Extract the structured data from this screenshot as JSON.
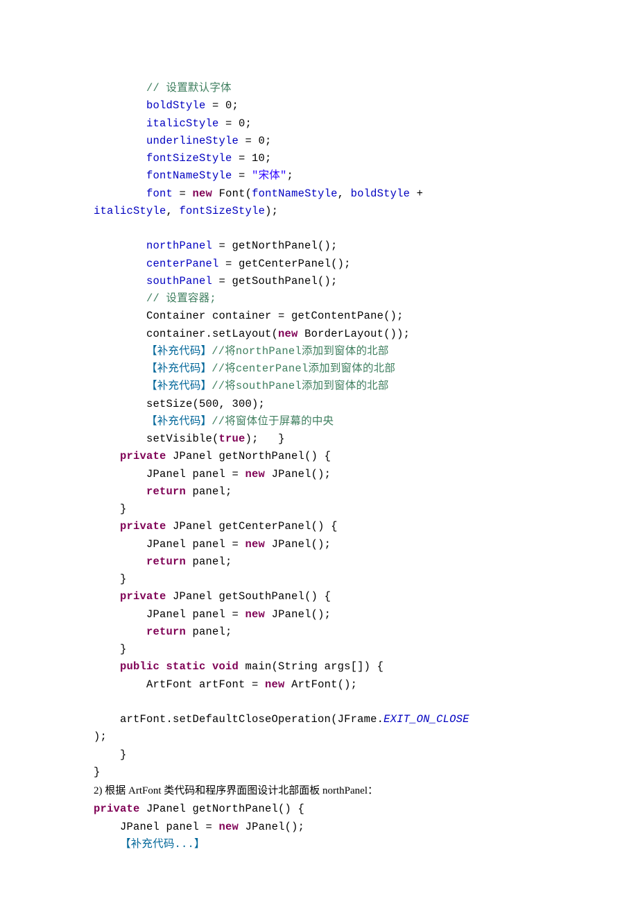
{
  "code1": {
    "l1": {
      "indent": "        ",
      "cm": "// 设置默认字体"
    },
    "l2": {
      "indent": "        ",
      "a": "boldStyle",
      "b": " = 0;"
    },
    "l3": {
      "indent": "        ",
      "a": "italicStyle",
      "b": " = 0;"
    },
    "l4": {
      "indent": "        ",
      "a": "underlineStyle",
      "b": " = 0;"
    },
    "l5": {
      "indent": "        ",
      "a": "fontSizeStyle",
      "b": " = 10;"
    },
    "l6": {
      "indent": "        ",
      "a": "fontNameStyle",
      "b": " = ",
      "c": "\"宋体\"",
      "d": ";"
    },
    "l7": {
      "indent": "        ",
      "a": "font",
      "b": " = ",
      "c": "new",
      "d": " Font(",
      "e": "fontNameStyle",
      "f": ", ",
      "g": "boldStyle",
      "h": " + "
    },
    "l8": {
      "a": "italicStyle",
      "b": ", ",
      "c": "fontSizeStyle",
      "d": ");"
    },
    "l10": {
      "indent": "        ",
      "a": "northPanel",
      "b": " = getNorthPanel();"
    },
    "l11": {
      "indent": "        ",
      "a": "centerPanel",
      "b": " = getCenterPanel();"
    },
    "l12": {
      "indent": "        ",
      "a": "southPanel",
      "b": " = getSouthPanel();"
    },
    "l13": {
      "indent": "        ",
      "cm": "// 设置容器;"
    },
    "l14": {
      "indent": "        ",
      "t": "Container container = getContentPane();"
    },
    "l15": {
      "indent": "        ",
      "a": "container.setLayout(",
      "b": "new",
      "c": " BorderLayout());"
    },
    "l16": {
      "indent": "        ",
      "a": "【补充代码】",
      "b": "//将",
      "c": "northPanel",
      "d": "添加到窗体的北部"
    },
    "l17": {
      "indent": "        ",
      "a": "【补充代码】",
      "b": "//将",
      "c": "centerPanel",
      "d": "添加到窗体的北部"
    },
    "l18": {
      "indent": "        ",
      "a": "【补充代码】",
      "b": "//将",
      "c": "southPanel",
      "d": "添加到窗体的北部"
    },
    "l19": {
      "indent": "        ",
      "t": "setSize(500, 300);"
    },
    "l20": {
      "indent": "        ",
      "a": "【补充代码】",
      "b": "//将窗体位于屏幕的中央"
    },
    "l21": {
      "indent": "        ",
      "a": "setVisible(",
      "b": "true",
      "c": ");   }"
    },
    "l22": {
      "indent": "    ",
      "a": "private",
      "b": " JPanel getNorthPanel() {"
    },
    "l23": {
      "indent": "        ",
      "a": "JPanel panel = ",
      "b": "new",
      "c": " JPanel();"
    },
    "l24": {
      "indent": "        ",
      "a": "return",
      "b": " panel;"
    },
    "l25": {
      "indent": "    ",
      "t": "}"
    },
    "l26": {
      "indent": "    ",
      "a": "private",
      "b": " JPanel getCenterPanel() {"
    },
    "l27": {
      "indent": "        ",
      "a": "JPanel panel = ",
      "b": "new",
      "c": " JPanel();"
    },
    "l28": {
      "indent": "        ",
      "a": "return",
      "b": " panel;"
    },
    "l29": {
      "indent": "    ",
      "t": "}"
    },
    "l30": {
      "indent": "    ",
      "a": "private",
      "b": " JPanel getSouthPanel() {"
    },
    "l31": {
      "indent": "        ",
      "a": "JPanel panel = ",
      "b": "new",
      "c": " JPanel();"
    },
    "l32": {
      "indent": "        ",
      "a": "return",
      "b": " panel;"
    },
    "l33": {
      "indent": "    ",
      "t": "}"
    },
    "l34": {
      "indent": "    ",
      "a": "public static void",
      "b": " main(String args[]) {"
    },
    "l35": {
      "indent": "        ",
      "a": "ArtFont artFont = ",
      "b": "new",
      "c": " ArtFont();"
    },
    "l37": {
      "indent": "    ",
      "a": "artFont.setDefaultCloseOperation(JFrame.",
      "b": "EXIT_ON_CLOSE"
    },
    "l38": {
      "t": ");"
    },
    "l39": {
      "indent": "    ",
      "t": "}"
    },
    "l40": {
      "t": "}"
    }
  },
  "q2": "2)   根据 ArtFont 类代码和程序界面图设计北部面板 northPanel：",
  "code2": {
    "l1": {
      "a": "private",
      "b": " JPanel getNorthPanel() {"
    },
    "l2": {
      "indent": "    ",
      "a": "JPanel panel = ",
      "b": "new",
      "c": " JPanel();"
    },
    "l3": {
      "indent": "    ",
      "a": "【补充代码...】"
    }
  }
}
